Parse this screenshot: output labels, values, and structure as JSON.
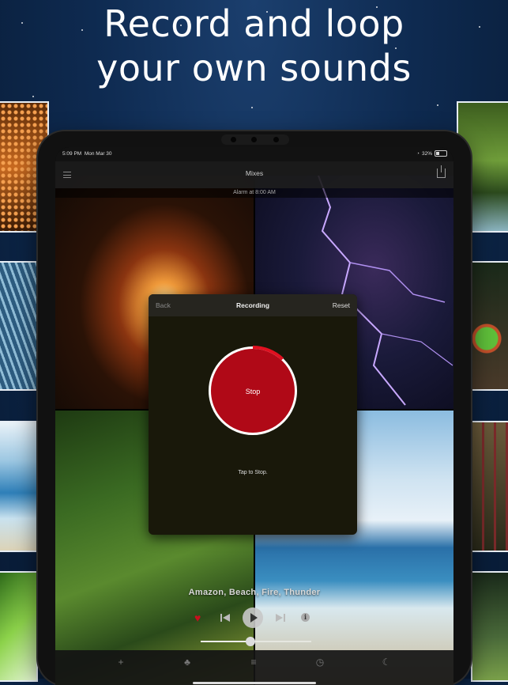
{
  "headline": {
    "line1": "Record and loop",
    "line2": "your own sounds"
  },
  "status_bar": {
    "time": "5:09 PM",
    "date": "Mon Mar 30",
    "battery": "32%"
  },
  "nav": {
    "title": "Mixes"
  },
  "alarm": {
    "text": "Alarm at 8:00 AM"
  },
  "recording_modal": {
    "back_label": "Back",
    "title": "Recording",
    "reset_label": "Reset",
    "stop_label": "Stop",
    "hint": "Tap to Stop.",
    "progress": 0.12
  },
  "player": {
    "mix_title": "Amazon, Beach, Fire, Thunder",
    "info_label": "i",
    "volume_level": 0.45
  },
  "tabs": [
    {
      "icon": "plus-icon"
    },
    {
      "icon": "shopping-icon"
    },
    {
      "icon": "list-icon"
    },
    {
      "icon": "clock-icon"
    },
    {
      "icon": "moon-icon"
    }
  ],
  "colors": {
    "accent_red": "#b00917",
    "background_blue": "#0e2a50"
  }
}
